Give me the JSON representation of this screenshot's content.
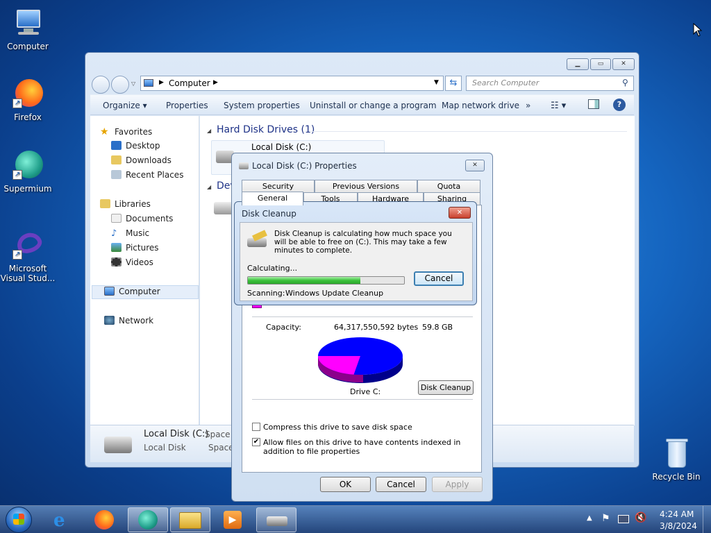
{
  "desktop": {
    "icons": [
      {
        "label": "Computer",
        "icon": "computer-icon"
      },
      {
        "label": "Firefox",
        "icon": "firefox-icon"
      },
      {
        "label": "Supermium",
        "icon": "supermium-icon"
      },
      {
        "label": "Microsoft Visual Stud...",
        "icon": "visual-studio-icon"
      },
      {
        "label": "Recycle Bin",
        "icon": "recycle-bin-icon"
      }
    ]
  },
  "explorer": {
    "address": "Computer",
    "search_placeholder": "Search Computer",
    "commands": [
      "Organize",
      "Properties",
      "System properties",
      "Uninstall or change a program",
      "Map network drive",
      "»"
    ],
    "nav": {
      "favorites": "Favorites",
      "desktop": "Desktop",
      "downloads": "Downloads",
      "recent": "Recent Places",
      "libraries": "Libraries",
      "documents": "Documents",
      "music": "Music",
      "pictures": "Pictures",
      "videos": "Videos",
      "computer": "Computer",
      "network": "Network"
    },
    "section_hdd": "Hard Disk Drives (1)",
    "section_dev": "Dev",
    "drive_name": "Local Disk (C:)",
    "details": {
      "name": "Local Disk (C:)",
      "type": "Local Disk",
      "space_used": "Space u",
      "space": "Space"
    }
  },
  "properties": {
    "title": "Local Disk (C:) Properties",
    "tabs_row1": [
      "Security",
      "Previous Versions",
      "Quota"
    ],
    "tabs_row2": [
      "General",
      "Tools",
      "Hardware",
      "Sharing"
    ],
    "capacity_label": "Capacity:",
    "capacity_bytes": "64,317,550,592 bytes",
    "capacity_gb": "59.8 GB",
    "drive_label": "Drive C:",
    "disk_cleanup_btn": "Disk Cleanup",
    "compress_label": "Compress this drive to save disk space",
    "index_label": "Allow files on this drive to have contents indexed in addition to file properties",
    "ok": "OK",
    "cancel": "Cancel",
    "apply": "Apply"
  },
  "cleanup": {
    "title": "Disk Cleanup",
    "message": "Disk Cleanup is calculating how much space you will be able to free on  (C:). This may take a few minutes to complete.",
    "calculating": "Calculating...",
    "progress": 0.72,
    "cancel": "Cancel",
    "scanning_label": "Scanning:",
    "scanning_item": "Windows Update Cleanup"
  },
  "taskbar": {
    "time": "4:24 AM",
    "date": "3/8/2024"
  },
  "colors": {
    "used": "#0000ff",
    "free": "#ff00ff",
    "progress": "#3cc23c"
  }
}
